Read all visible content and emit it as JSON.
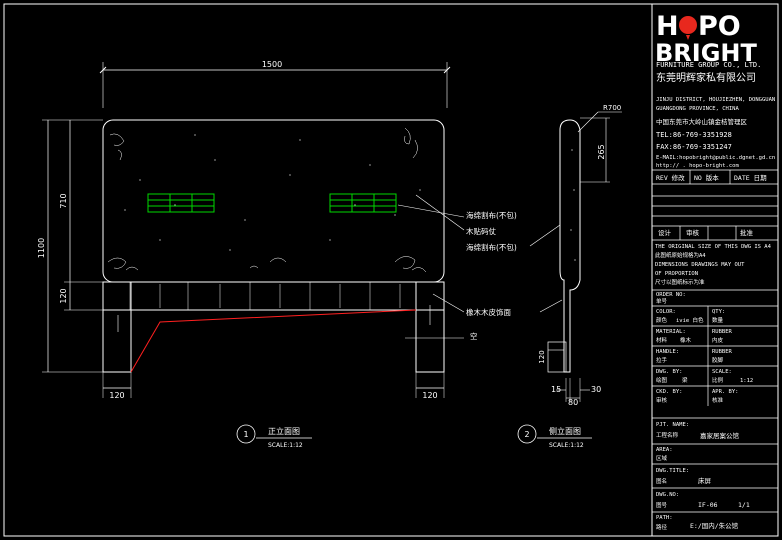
{
  "logo": {
    "brand_top": "HOPO",
    "brand_bottom": "BRIGHT",
    "group": "FURNITURE GROUP CO., LTD.",
    "cn_name": "东莞明辉家私有限公司"
  },
  "address": {
    "en_1": "JINJU DISTRICT, HOUJIEZHEN, DONGGUAN",
    "en_2": "GUANGDONG PROVINCE, CHINA",
    "cn": "中国东莞市大岭山镇金桔管理区",
    "tel": "TEL:86-769-3351928",
    "fax": "FAX:86-769-3351247",
    "email": "E-MAIL:hopobright@public.dgnet.gd.cn",
    "http": "http://  . hopo-bright.com"
  },
  "revision": {
    "rev": "REV 修改",
    "no": "NO 版本",
    "date": "DATE 日期"
  },
  "approvals": {
    "a1": "设计",
    "a2": "审核",
    "a3": "批准"
  },
  "notes": {
    "n1": "THE ORIGINAL SIZE OF THIS DWG IS A4",
    "n2": "此图纸原始规格为A4",
    "n3": "DIMENSIONS DRAWINGS MAY OUT",
    "n4": "OF PROPORTION",
    "n5": "尺寸以图纸标示为准"
  },
  "fields": {
    "order_label": "ORDER NO:",
    "order_cn": "单号",
    "color_label": "COLOR:",
    "color_cn": "颜色",
    "color_value": "ivie 白色",
    "qty_label": "QTY:",
    "qty_cn": "数量",
    "material_label": "MATERIAL:",
    "material_cn": "材料",
    "material_value": "橡木",
    "rubber_label": "RUBBER",
    "rubber_cn": "内皮",
    "handle_label": "HANDLE:",
    "handle_cn": "拉手",
    "rubber2_label": "RUBBER",
    "rubber2_cn": "胶脚",
    "dwg_by_label": "DWG. BY:",
    "dwg_by_cn": "绘图",
    "dwg_by_value": "梁",
    "scale_label": "SCALE:",
    "scale_cn": "比例",
    "scale_value": "1:12",
    "ckd_label": "CKD. BY:",
    "ckd_cn": "审核",
    "apr_label": "APR. BY:",
    "apr_cn": "核准",
    "prj_label": "PJT. NAME:",
    "prj_cn": "工程名称",
    "prj_value": "嘉家居案公馆",
    "area_label": "AREA:",
    "area_cn": "区域",
    "title_label": "DWG.TITLE:",
    "title_cn": "图名",
    "title_value": "床屏",
    "dwgno_label": "DWG.NO:",
    "dwgno_cn": "图号",
    "dwgno_value": "IF-06",
    "sheet_value": "1/1",
    "path_label": "PATH:",
    "path_cn": "路径",
    "path_value": "E:/国内/朱公馆"
  },
  "drawing": {
    "dim_width": "1500",
    "dim_height_total": "1100",
    "dim_height_panel": "710",
    "dim_base": "120",
    "dim_leg_left": "120",
    "dim_leg_right": "120",
    "side_r": "R700",
    "side_265": "265",
    "side_120": "120",
    "side_15": "15",
    "side_30": "30",
    "side_80": "80",
    "label_fabric_1": "海绵割布(不包)",
    "label_wood_trim": "木贴码仗",
    "label_fabric_2": "海绵割布(不包)",
    "label_veneer": "橡木木皮饰面",
    "label_empty": "空",
    "view1_num": "1",
    "view1_title": "正立面图",
    "view1_scale": "SCALE:1:12",
    "view2_num": "2",
    "view2_title": "侧立面图",
    "view2_scale": "SCALE:1:12"
  },
  "colors": {
    "logo_red": "#e8281e",
    "line_white": "#ffffff",
    "green": "#00d800",
    "red": "#ff2020"
  }
}
